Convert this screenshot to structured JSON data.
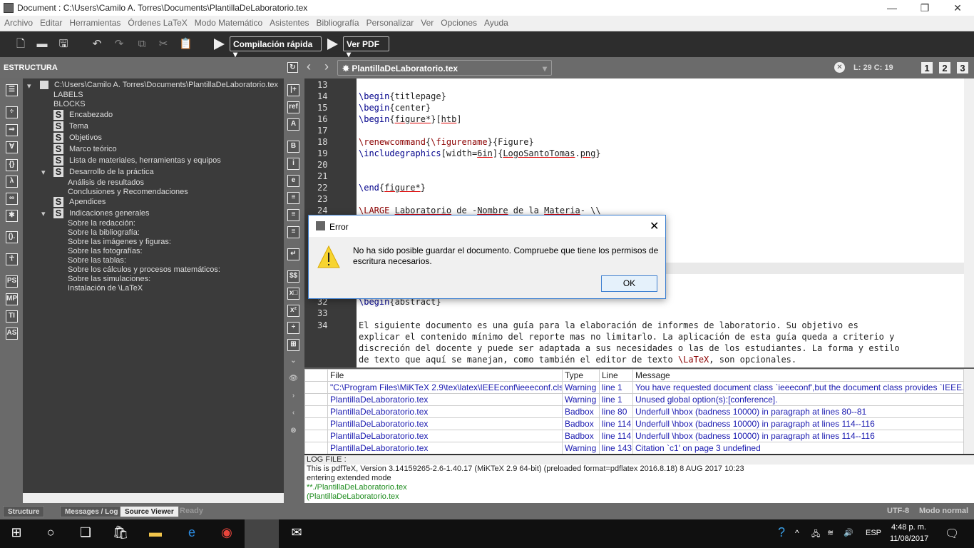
{
  "window": {
    "title": "Document : C:\\Users\\Camilo A. Torres\\Documents\\PlantillaDeLaboratorio.tex"
  },
  "menu": [
    "Archivo",
    "Editar",
    "Herramientas",
    "Órdenes LaTeX",
    "Modo Matemático",
    "Asistentes",
    "Bibliografía",
    "Personalizar",
    "Ver",
    "Opciones",
    "Ayuda"
  ],
  "toolbar": {
    "compile": "Compilación rápida",
    "view": "Ver PDF"
  },
  "structure": {
    "header": "ESTRUCTURA",
    "root": "C:\\Users\\Camilo A. Torres\\Documents\\PlantillaDeLaboratorio.tex",
    "items": [
      {
        "label": "LABELS",
        "level": 0,
        "badge": false
      },
      {
        "label": "BLOCKS",
        "level": 0,
        "badge": false
      },
      {
        "label": "Encabezado",
        "level": 0,
        "badge": true
      },
      {
        "label": "Tema",
        "level": 0,
        "badge": true
      },
      {
        "label": "Objetivos",
        "level": 0,
        "badge": true
      },
      {
        "label": "Marco teórico",
        "level": 0,
        "badge": true
      },
      {
        "label": "Lista de materiales, herramientas y equipos",
        "level": 0,
        "badge": true
      },
      {
        "label": "Desarrollo de la práctica",
        "level": 0,
        "badge": true,
        "expanded": true
      },
      {
        "label": "Análisis de resultados",
        "level": 1,
        "badge": false
      },
      {
        "label": "Conclusiones y Recomendaciones",
        "level": 1,
        "badge": false
      },
      {
        "label": "Apendices",
        "level": 0,
        "badge": true
      },
      {
        "label": "Indicaciones generales",
        "level": 0,
        "badge": true,
        "expanded": true
      },
      {
        "label": "Sobre la redacción:",
        "level": 1,
        "badge": false
      },
      {
        "label": "Sobre la bibliografía:",
        "level": 1,
        "badge": false
      },
      {
        "label": "Sobre las imágenes y figuras:",
        "level": 1,
        "badge": false
      },
      {
        "label": "Sobre las fotografías:",
        "level": 1,
        "badge": false
      },
      {
        "label": "Sobre las tablas:",
        "level": 1,
        "badge": false
      },
      {
        "label": "Sobre los cálculos y procesos matemáticos:",
        "level": 1,
        "badge": false
      },
      {
        "label": "Sobre las simulaciones:",
        "level": 1,
        "badge": false
      },
      {
        "label": "Instalación de \\LaTeX",
        "level": 1,
        "badge": false
      }
    ]
  },
  "editor": {
    "file": "PlantillaDeLaboratorio.tex",
    "position": "L: 29 C: 19",
    "views": [
      "1",
      "2",
      "3"
    ],
    "lines": [
      {
        "n": "13",
        "s": []
      },
      {
        "n": "14",
        "s": [
          {
            "t": "\\begin",
            "c": "k"
          },
          {
            "t": "{titlepage}"
          }
        ]
      },
      {
        "n": "15",
        "s": [
          {
            "t": "\\begin",
            "c": "k"
          },
          {
            "t": "{center}"
          }
        ]
      },
      {
        "n": "16",
        "s": [
          {
            "t": "\\begin",
            "c": "k"
          },
          {
            "t": "{"
          },
          {
            "t": "figure*",
            "c": "u"
          },
          {
            "t": "}["
          },
          {
            "t": "htb",
            "c": "u"
          },
          {
            "t": "]"
          }
        ]
      },
      {
        "n": "17",
        "s": []
      },
      {
        "n": "18",
        "s": [
          {
            "t": "\\renewcommand",
            "c": "r"
          },
          {
            "t": "{"
          },
          {
            "t": "\\figurename",
            "c": "r"
          },
          {
            "t": "}{Figure}"
          }
        ]
      },
      {
        "n": "19",
        "s": [
          {
            "t": "\\includegraphics",
            "c": "k"
          },
          {
            "t": "[width="
          },
          {
            "t": "6in",
            "c": "u"
          },
          {
            "t": "]{"
          },
          {
            "t": "LogoSantoTomas",
            "c": "u"
          },
          {
            "t": "."
          },
          {
            "t": "png",
            "c": "u"
          },
          {
            "t": "}"
          }
        ]
      },
      {
        "n": "20",
        "s": []
      },
      {
        "n": "21",
        "s": []
      },
      {
        "n": "22",
        "s": [
          {
            "t": "\\end",
            "c": "k"
          },
          {
            "t": "{"
          },
          {
            "t": "figure*",
            "c": "u"
          },
          {
            "t": "}"
          }
        ]
      },
      {
        "n": "23",
        "s": []
      },
      {
        "n": "24",
        "s": [
          {
            "t": "\\LARGE",
            "c": "r"
          },
          {
            "t": " "
          },
          {
            "t": "Laboratorio",
            "c": "u"
          },
          {
            "t": " de -"
          },
          {
            "t": "Nombre",
            "c": "u"
          },
          {
            "t": " de la "
          },
          {
            "t": "Materia",
            "c": "u"
          },
          {
            "t": "- \\\\"
          }
        ]
      },
      {
        "n": "32",
        "s": [
          {
            "t": "\\begin",
            "c": "k"
          },
          {
            "t": "{abstract}"
          }
        ]
      },
      {
        "n": "33",
        "s": []
      },
      {
        "n": "34",
        "s": [
          {
            "t": "El siguiente documento es una guía para la elaboración de informes de laboratorio. Su objetivo es"
          }
        ]
      },
      {
        "n": "",
        "s": [
          {
            "t": "explicar el contenido mínimo del reporte mas no limitarlo. La aplicación de esta guía queda a criterio y"
          }
        ]
      },
      {
        "n": "",
        "s": [
          {
            "t": "discreción del docente y puede ser adaptada a sus necesidades o las de los estudiantes. La forma y estilo"
          }
        ]
      },
      {
        "n": "",
        "s": [
          {
            "t": "de texto que aquí se manejan, como también el editor de texto "
          },
          {
            "t": "\\LaTeX",
            "c": "r"
          },
          {
            "t": ", son opcionales."
          }
        ]
      }
    ]
  },
  "messages": {
    "columns": [
      "File",
      "Type",
      "Line",
      "Message"
    ],
    "rows": [
      [
        "\"C:\\Program Files\\MiKTeX 2.9\\tex\\latex\\IEEEconf\\ieeeconf.cls",
        "Warning",
        "line 1",
        "You have requested document class `ieeeconf',but the document class provides `IEEE..."
      ],
      [
        "PlantillaDeLaboratorio.tex",
        "Warning",
        "line 1",
        "Unused global option(s):[conference]."
      ],
      [
        "PlantillaDeLaboratorio.tex",
        "Badbox",
        "line 80",
        "Underfull \\hbox (badness 10000) in paragraph at lines 80--81"
      ],
      [
        "PlantillaDeLaboratorio.tex",
        "Badbox",
        "line 114",
        "Underfull \\hbox (badness 10000) in paragraph at lines 114--116"
      ],
      [
        "PlantillaDeLaboratorio.tex",
        "Badbox",
        "line 114",
        "Underfull \\hbox (badness 10000) in paragraph at lines 114--116"
      ],
      [
        "PlantillaDeLaboratorio.tex",
        "Warning",
        "line 143",
        "Citation `c1' on page 3 undefined"
      ]
    ]
  },
  "log": {
    "lines": [
      {
        "t": "LOG FILE :",
        "c": "#222"
      },
      {
        "t": "This is pdfTeX, Version 3.14159265-2.6-1.40.17 (MiKTeX 2.9 64-bit) (preloaded format=pdflatex 2016.8.18) 8 AUG 2017 10:23",
        "c": "#222"
      },
      {
        "t": "entering extended mode",
        "c": "#222"
      },
      {
        "t": "**./PlantillaDeLaboratorio.tex",
        "c": "#1a8a1a"
      },
      {
        "t": "(PlantillaDeLaboratorio.tex",
        "c": "#1a8a1a"
      }
    ]
  },
  "statusbar": {
    "tabs": [
      "Structure",
      "Messages / Log",
      "Source Viewer"
    ],
    "state": "Ready",
    "encoding": "UTF-8",
    "mode": "Modo normal"
  },
  "dialog": {
    "title": "Error",
    "message": "No ha sido posible guardar el documento. Compruebe que tiene los permisos de escritura necesarios.",
    "ok": "OK"
  },
  "taskbar": {
    "time": "4:48 p. m.",
    "date": "11/08/2017",
    "lang": "ESP"
  }
}
